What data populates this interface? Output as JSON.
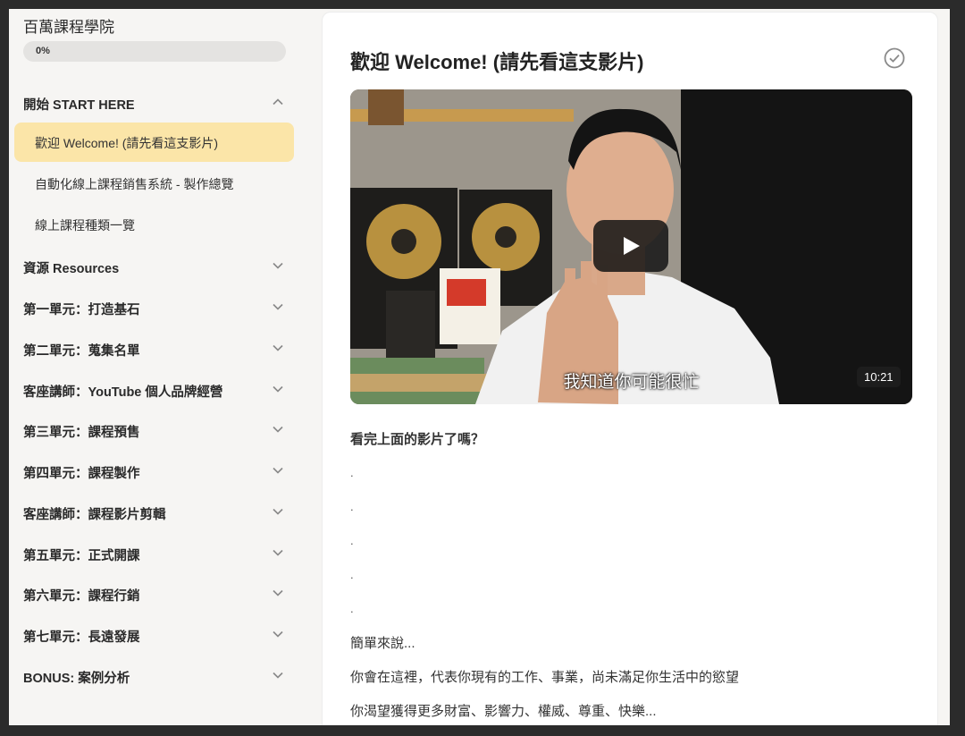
{
  "sidebar": {
    "school_title": "百萬課程學院",
    "progress": {
      "label": "0%",
      "value": 0
    },
    "sections": [
      {
        "title": "開始 START HERE",
        "expanded": true,
        "chevron": "chevron-up-icon"
      },
      {
        "title": "資源 Resources",
        "expanded": false,
        "chevron": "chevron-down-icon"
      },
      {
        "title": "第一單元：打造基石",
        "expanded": false,
        "chevron": "chevron-down-icon"
      },
      {
        "title": "第二單元：蒐集名單",
        "expanded": false,
        "chevron": "chevron-down-icon"
      },
      {
        "title": "客座講師：YouTube 個人品牌經營",
        "expanded": false,
        "chevron": "chevron-down-icon"
      },
      {
        "title": "第三單元：課程預售",
        "expanded": false,
        "chevron": "chevron-down-icon"
      },
      {
        "title": "第四單元：課程製作",
        "expanded": false,
        "chevron": "chevron-down-icon"
      },
      {
        "title": "客座講師：課程影片剪輯",
        "expanded": false,
        "chevron": "chevron-down-icon"
      },
      {
        "title": "第五單元：正式開課",
        "expanded": false,
        "chevron": "chevron-down-icon"
      },
      {
        "title": "第六單元：課程行銷",
        "expanded": false,
        "chevron": "chevron-down-icon"
      },
      {
        "title": "第七單元：長遠發展",
        "expanded": false,
        "chevron": "chevron-down-icon"
      },
      {
        "title": "BONUS: 案例分析",
        "expanded": false,
        "chevron": "chevron-down-icon"
      }
    ],
    "lessons": [
      {
        "label": "歡迎 Welcome! (請先看這支影片)",
        "active": true
      },
      {
        "label": "自動化線上課程銷售系統 - 製作總覽",
        "active": false
      },
      {
        "label": "線上課程種類一覽",
        "active": false
      }
    ]
  },
  "main": {
    "heading": "歡迎 Welcome! (請先看這支影片)",
    "complete_icon": "check-circle-icon",
    "video": {
      "subtitle": "我知道你可能很忙",
      "duration": "10:21",
      "play_icon": "play-icon"
    },
    "paragraphs": [
      "看完上面的影片了嗎？",
      ".",
      ".",
      ".",
      ".",
      ".",
      "簡單來說...",
      "你會在這裡，代表你現有的工作、事業，尚未滿足你生活中的慾望",
      "你渴望獲得更多財富、影響力、權威、尊重、快樂..."
    ]
  },
  "colors": {
    "accent": "#fbe5a8",
    "sidebar_bg": "#f6f5f3",
    "progress_fill": "#f2c94c"
  }
}
